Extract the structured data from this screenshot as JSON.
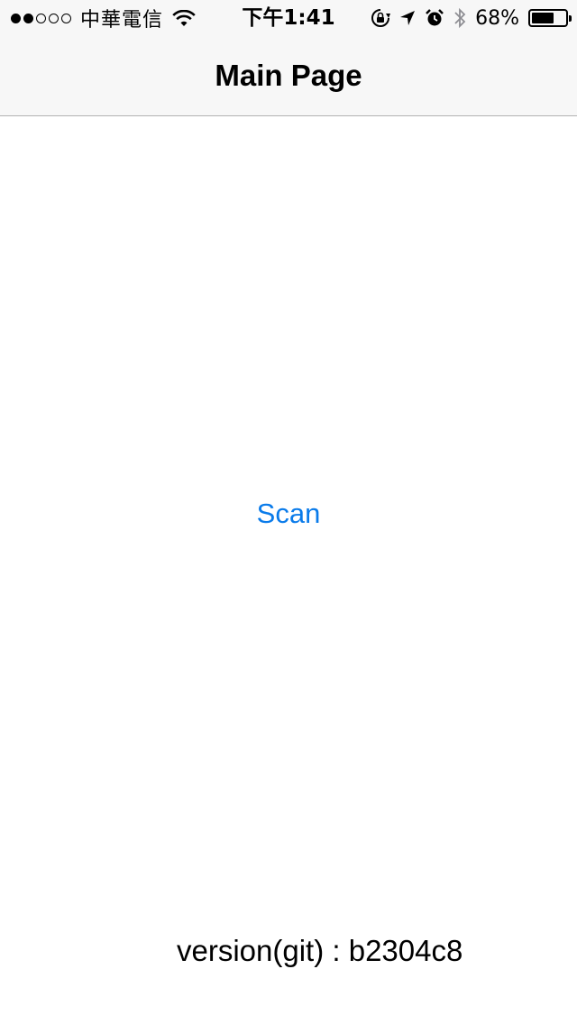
{
  "status_bar": {
    "signal_bars_filled": 2,
    "signal_bars_total": 5,
    "carrier": "中華電信",
    "time": "下午1:41",
    "battery_percent": "68%",
    "battery_level": 0.68,
    "icons": [
      "wifi-icon",
      "orientation-lock-icon",
      "location-arrow-icon",
      "alarm-icon",
      "bluetooth-icon",
      "battery-icon"
    ]
  },
  "nav": {
    "title": "Main Page"
  },
  "main": {
    "scan_label": "Scan",
    "scan_color": "#0a7bea"
  },
  "footer": {
    "version_text": "version(git) : b2304c8"
  }
}
